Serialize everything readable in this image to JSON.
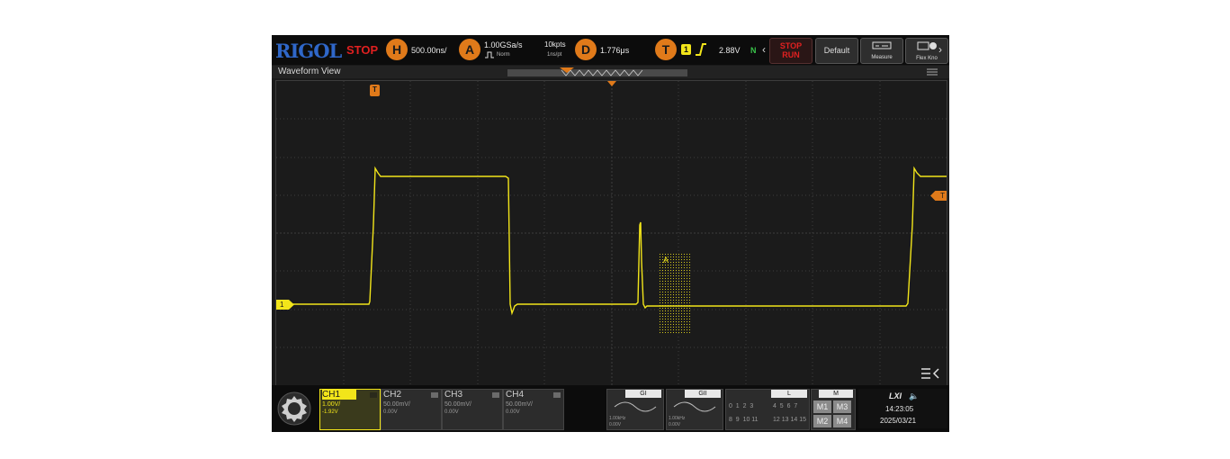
{
  "topbar": {
    "brand": "RIGOL",
    "status": "STOP",
    "horizontal": {
      "key": "H",
      "timebase": "500.00ns/"
    },
    "acquire": {
      "key": "A",
      "sample_rate": "1.00GSa/s",
      "mode": "Norm",
      "mem_depth": "10kpts",
      "time_per_pt": "1ns/pt"
    },
    "delay": {
      "key": "D",
      "value": "1.776μs"
    },
    "trigger": {
      "key": "T",
      "source": "1",
      "level": "2.88V",
      "sweep": "N"
    },
    "stop_run": {
      "line1": "STOP",
      "line2": "RUN"
    },
    "default_label": "Default",
    "measure_label": "Measure",
    "flex_label": "Flex Kno"
  },
  "waveform_view": {
    "title": "Waveform View"
  },
  "markers": {
    "trigger_pos": "T",
    "trigger_level": "T",
    "ch1": "1",
    "cursor_zone": "A"
  },
  "channels": [
    {
      "name": "CH1",
      "scale": "1.00V/",
      "offset": "-1.92V",
      "color": "#f2e51a",
      "active": true
    },
    {
      "name": "CH2",
      "scale": "50.00mV/",
      "offset": "0.00V",
      "color": "#2ed3e6",
      "active": false
    },
    {
      "name": "CH3",
      "scale": "50.00mV/",
      "offset": "0.00V",
      "color": "#d35ad3",
      "active": false
    },
    {
      "name": "CH4",
      "scale": "50.00mV/",
      "offset": "0.00V",
      "color": "#3d8cf0",
      "active": false
    }
  ],
  "generators": [
    {
      "name": "GI",
      "freq": "1.00kHz",
      "amp": "0.00V"
    },
    {
      "name": "GII",
      "freq": "1.00kHz",
      "amp": "0.00V"
    }
  ],
  "logic": {
    "label": "L",
    "row1": "0  1  2  3",
    "row1b": "4  5  6  7",
    "row2": "8  9  10 11",
    "row2b": "12 13 14 15"
  },
  "math": {
    "label": "M",
    "buttons": [
      "M1",
      "M3",
      "M2",
      "M4"
    ]
  },
  "status": {
    "lxi": "LXI",
    "time": "14:23:05",
    "date": "2025/03/21"
  },
  "colors": {
    "ch1": "#f2e51a",
    "trigger": "#e07a1a",
    "brand": "#2f67c9",
    "stop": "#e02020"
  }
}
